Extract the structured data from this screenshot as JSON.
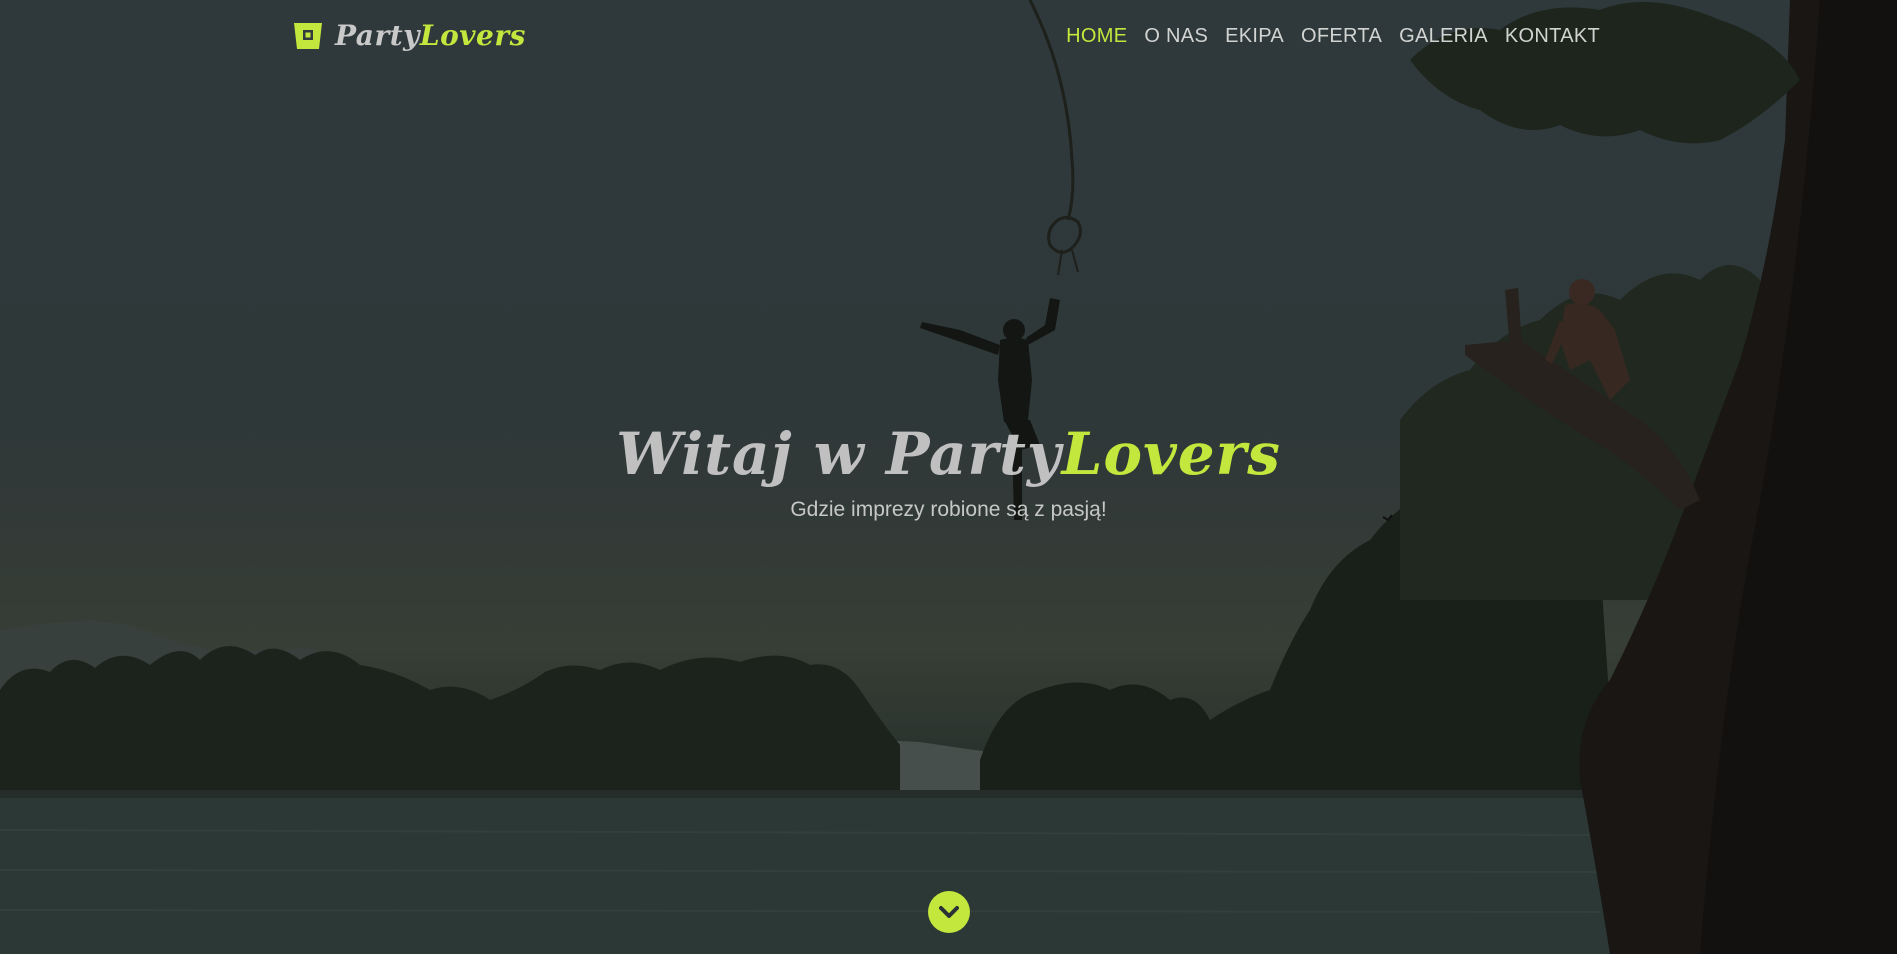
{
  "brand": {
    "name_part1": "Party",
    "name_part2": "Lovers",
    "icon": "cup-icon"
  },
  "nav": {
    "items": [
      {
        "label": "HOME",
        "active": true
      },
      {
        "label": "O NAS",
        "active": false
      },
      {
        "label": "EKIPA",
        "active": false
      },
      {
        "label": "OFERTA",
        "active": false
      },
      {
        "label": "GALERIA",
        "active": false
      },
      {
        "label": "KONTAKT",
        "active": false
      }
    ]
  },
  "hero": {
    "title_part1": "Witaj w Party",
    "title_part2": "Lovers",
    "subtitle": "Gdzie imprezy robione są z pasją!",
    "scroll_icon": "chevron-down-icon"
  },
  "colors": {
    "accent": "#c3e73c",
    "nav_text": "#d2d4d2",
    "background": "#323b3e"
  }
}
